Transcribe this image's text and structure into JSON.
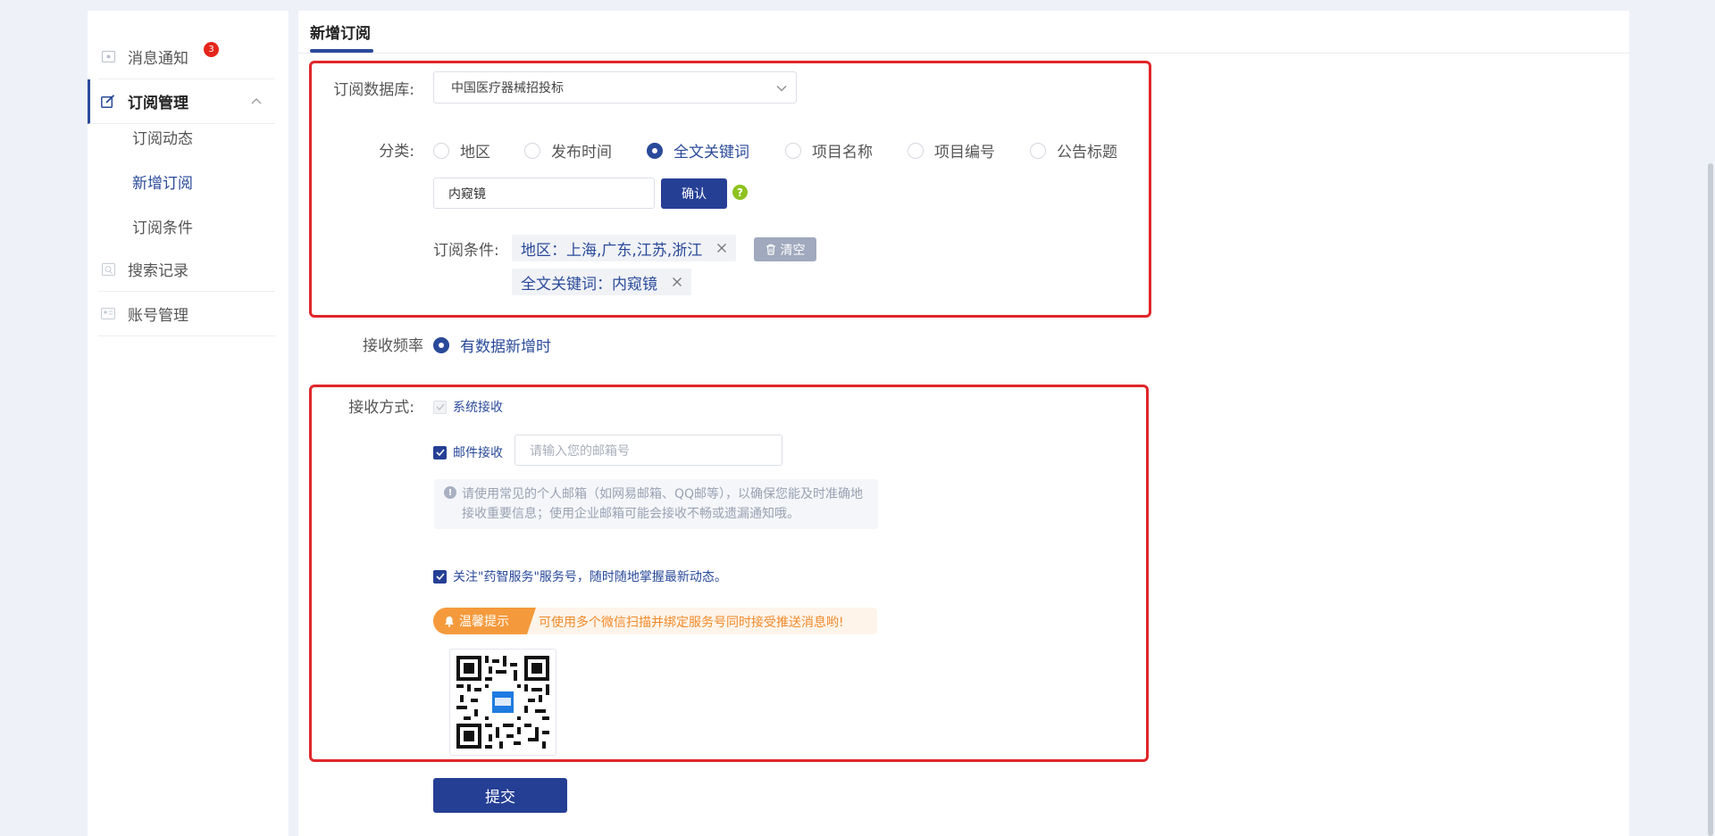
{
  "sidebar": {
    "items": [
      {
        "label": "消息通知",
        "badge": "3"
      },
      {
        "label": "订阅管理"
      },
      {
        "label": "搜索记录"
      },
      {
        "label": "账号管理"
      }
    ],
    "subitems": [
      {
        "label": "订阅动态"
      },
      {
        "label": "新增订阅"
      },
      {
        "label": "订阅条件"
      }
    ]
  },
  "main": {
    "tab": "新增订阅",
    "database": {
      "label": "订阅数据库:",
      "value": "中国医疗器械招投标"
    },
    "category": {
      "label": "分类:",
      "options": [
        "地区",
        "发布时间",
        "全文关键词",
        "项目名称",
        "项目编号",
        "公告标题"
      ],
      "selected": "全文关键词"
    },
    "keyword_input": {
      "value": "内窥镜"
    },
    "confirm_label": "确认",
    "help_icon": "?",
    "conditions": {
      "label": "订阅条件:",
      "tags": [
        "地区：上海,广东,江苏,浙江",
        "全文关键词：内窥镜"
      ],
      "clear_label": "清空"
    },
    "frequency": {
      "label": "接收频率",
      "option": "有数据新增时"
    },
    "receive": {
      "label": "接收方式:",
      "system_label": "系统接收",
      "email_label": "邮件接收",
      "email_placeholder": "请输入您的邮箱号",
      "email_notice": "请使用常见的个人邮箱（如网易邮箱、QQ邮等），以确保您能及时准确地接收重要信息；使用企业邮箱可能会接收不畅或遗漏通知哦。",
      "wechat_label": "关注\"药智服务\"服务号，随时随地掌握最新动态。",
      "tip_badge": "温馨提示",
      "tip_text": "可使用多个微信扫描并绑定服务号同时接受推送消息哟!"
    },
    "submit_label": "提交"
  },
  "colors": {
    "primary": "#253f95",
    "highlight_box": "#e0262a",
    "badge": "#e5251b",
    "tip": "#f59a3c"
  }
}
